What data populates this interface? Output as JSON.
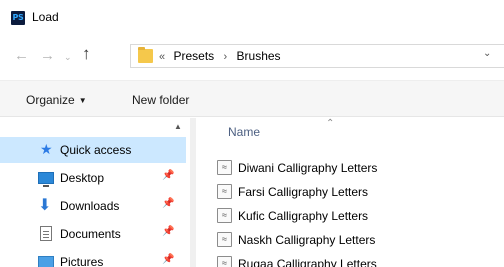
{
  "window": {
    "title": "Load",
    "app_icon": "PS"
  },
  "address": {
    "overflow": "«",
    "crumbs": [
      "Presets",
      "Brushes"
    ],
    "separator": "›"
  },
  "toolbar": {
    "organize_label": "Organize",
    "new_folder_label": "New folder"
  },
  "nav_pane": {
    "items": [
      {
        "label": "Quick access",
        "icon": "star-icon",
        "selected": true
      },
      {
        "label": "Desktop",
        "icon": "desktop-icon",
        "pinned": true
      },
      {
        "label": "Downloads",
        "icon": "download-arrow-icon",
        "pinned": true
      },
      {
        "label": "Documents",
        "icon": "document-icon",
        "pinned": true
      },
      {
        "label": "Pictures",
        "icon": "pictures-icon",
        "pinned": true
      }
    ]
  },
  "file_list": {
    "column_name": "Name",
    "files": [
      "Diwani Calligraphy Letters",
      "Farsi Calligraphy Letters",
      "Kufic Calligraphy Letters",
      "Naskh Calligraphy Letters",
      "Ruqaa Calligraphy Letters"
    ]
  },
  "colors": {
    "selection": "#cce8ff",
    "column_header": "#4d6082",
    "ps_icon_bg": "#0b1b3d",
    "ps_icon_fg": "#31a8ff"
  }
}
